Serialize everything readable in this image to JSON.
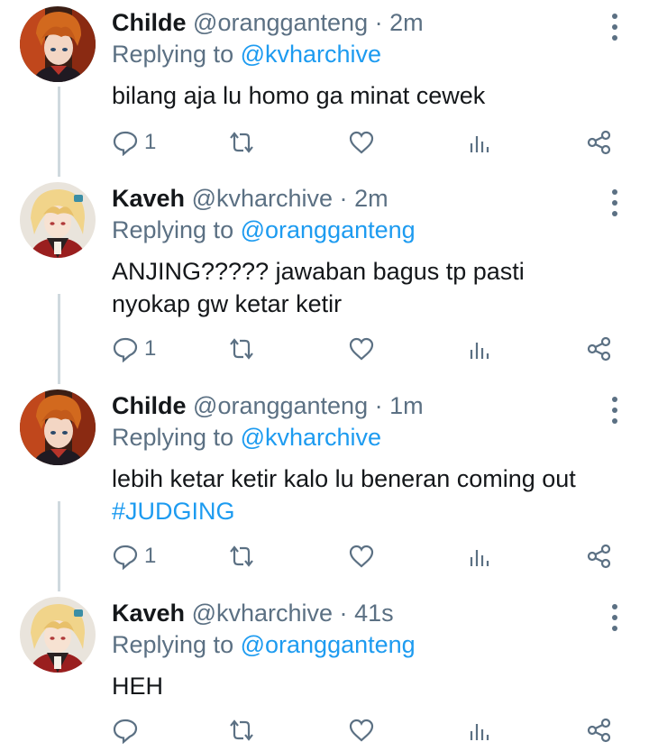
{
  "tweets": [
    {
      "name": "Childe",
      "handle": "@orangganteng",
      "time": "2m",
      "replying_prefix": "Replying to",
      "replying_to": "@kvharchive",
      "text": "bilang aja lu homo ga minat cewek",
      "hashtag": "",
      "reply_count": "1",
      "avatar": "childe"
    },
    {
      "name": "Kaveh",
      "handle": "@kvharchive",
      "time": "2m",
      "replying_prefix": "Replying to",
      "replying_to": "@orangganteng",
      "text": "ANJING????? jawaban bagus tp pasti nyokap gw ketar ketir",
      "hashtag": "",
      "reply_count": "1",
      "avatar": "kaveh"
    },
    {
      "name": "Childe",
      "handle": "@orangganteng",
      "time": "1m",
      "replying_prefix": "Replying to",
      "replying_to": "@kvharchive",
      "text": "lebih ketar ketir kalo lu beneran coming out",
      "hashtag": "#JUDGING",
      "reply_count": "1",
      "avatar": "childe"
    },
    {
      "name": "Kaveh",
      "handle": "@kvharchive",
      "time": "41s",
      "replying_prefix": "Replying to",
      "replying_to": "@orangganteng",
      "text": "HEH",
      "hashtag": "",
      "reply_count": "",
      "avatar": "kaveh"
    }
  ],
  "icons": {
    "reply": "reply-icon",
    "retweet": "retweet-icon",
    "like": "heart-icon",
    "analytics": "analytics-icon",
    "share": "share-icon",
    "more": "more-vertical-icon"
  },
  "colors": {
    "link": "#1d9bf0",
    "muted": "#5b7083",
    "thread_line": "#cfd9de"
  }
}
